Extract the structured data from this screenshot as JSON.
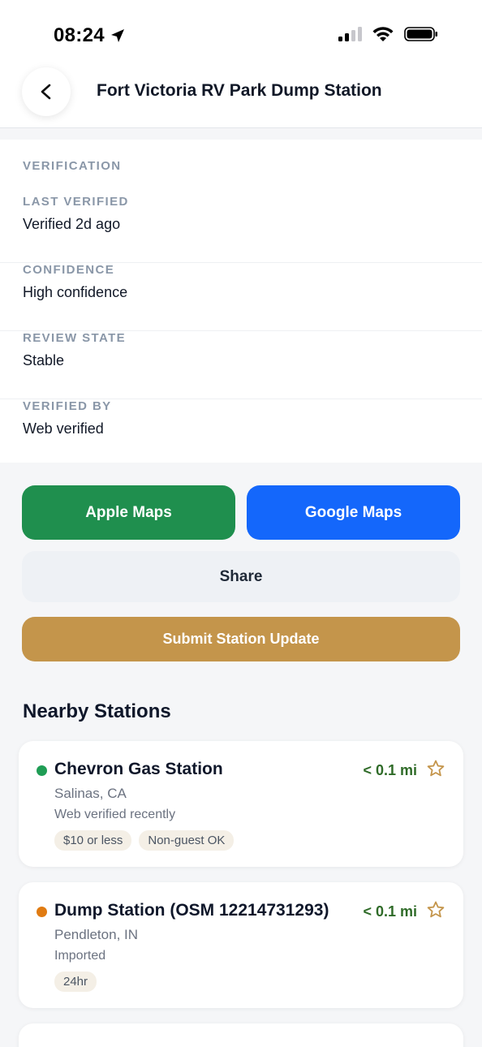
{
  "status_bar": {
    "time": "08:24"
  },
  "header": {
    "title": "Fort Victoria RV Park Dump Station"
  },
  "verification": {
    "section_label": "VERIFICATION",
    "rows": [
      {
        "label": "LAST VERIFIED",
        "value": "Verified 2d ago"
      },
      {
        "label": "CONFIDENCE",
        "value": "High confidence"
      },
      {
        "label": "REVIEW STATE",
        "value": "Stable"
      },
      {
        "label": "VERIFIED BY",
        "value": "Web verified"
      }
    ]
  },
  "actions": {
    "apple_maps": "Apple Maps",
    "google_maps": "Google Maps",
    "share": "Share",
    "submit_update": "Submit Station Update"
  },
  "nearby": {
    "title": "Nearby Stations",
    "stations": [
      {
        "name": "Chevron Gas Station",
        "distance": "< 0.1 mi",
        "location": "Salinas, CA",
        "status": "Web verified recently",
        "status_color": "#1f9d55",
        "tags": [
          "$10 or less",
          "Non-guest OK"
        ]
      },
      {
        "name": "Dump Station (OSM 12214731293)",
        "distance": "< 0.1 mi",
        "location": "Pendleton, IN",
        "status": "Imported",
        "status_color": "#e07b12",
        "tags": [
          "24hr"
        ]
      }
    ]
  },
  "colors": {
    "apple_maps": "#1f8f4e",
    "google_maps": "#1467fb",
    "submit": "#c4954b",
    "distance": "#2f6b28",
    "star": "#c4954b"
  }
}
